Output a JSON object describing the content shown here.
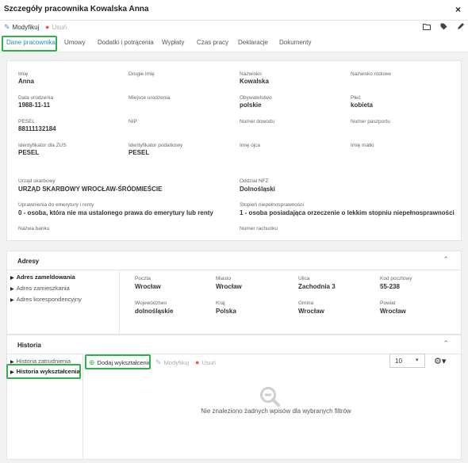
{
  "window": {
    "title": "Szczegóły pracownika Kowalska Anna",
    "close_label": "×"
  },
  "toolbar": {
    "modify_label": "Modyfikuj",
    "delete_label": "Usuń"
  },
  "tabs": [
    {
      "label": "Dane pracownika",
      "active": true
    },
    {
      "label": "Umowy"
    },
    {
      "label": "Dodatki i potrącenia"
    },
    {
      "label": "Wypłaty"
    },
    {
      "label": "Czas pracy"
    },
    {
      "label": "Deklaracje"
    },
    {
      "label": "Dokumenty"
    }
  ],
  "details": {
    "imie": {
      "label": "Imię",
      "value": "Anna"
    },
    "drugie_imie": {
      "label": "Drugie imię",
      "value": ""
    },
    "nazwisko": {
      "label": "Nazwisko",
      "value": "Kowalska"
    },
    "nazwisko_rodowe": {
      "label": "Nazwisko rodowe",
      "value": ""
    },
    "data_urodzenia": {
      "label": "Data urodzenia",
      "value": "1988-11-11"
    },
    "miejsce_urodzenia": {
      "label": "Miejsce urodzenia",
      "value": ""
    },
    "obywatelstwo": {
      "label": "Obywatelstwo",
      "value": "polskie"
    },
    "plec": {
      "label": "Płeć",
      "value": "kobieta"
    },
    "pesel": {
      "label": "PESEL",
      "value": "88111132184"
    },
    "nip": {
      "label": "NIP",
      "value": ""
    },
    "numer_dowodu": {
      "label": "Numer dowodu",
      "value": ""
    },
    "numer_paszportu": {
      "label": "Numer paszportu",
      "value": ""
    },
    "id_zus": {
      "label": "Identyfikator dla ZUS",
      "value": "PESEL"
    },
    "id_podatkowy": {
      "label": "Identyfikator podatkowy",
      "value": "PESEL"
    },
    "imie_ojca": {
      "label": "Imię ojca",
      "value": ""
    },
    "imie_matki": {
      "label": "Imię matki",
      "value": ""
    },
    "urzad_skarbowy": {
      "label": "Urząd skarbowy",
      "value": "URZĄD SKARBOWY WROCŁAW-ŚRÓDMIEŚCIE"
    },
    "oddzial_nfz": {
      "label": "Oddział NFZ",
      "value": "Dolnośląski"
    },
    "uprawnienia": {
      "label": "Uprawnienia do emerytury i renty",
      "value": "0 - osoba, która nie ma ustalonego prawa do emerytury lub renty"
    },
    "niepelnosprawnosc": {
      "label": "Stopień niepełnosprawności",
      "value": "1 - osoba posiadająca orzeczenie o lekkim stopniu niepełnosprawności"
    },
    "nazwa_banku": {
      "label": "Nazwa banku",
      "value": ""
    },
    "numer_rachunku": {
      "label": "Numer rachunku",
      "value": ""
    }
  },
  "addresses": {
    "title": "Adresy",
    "side": [
      "Adres zameldowania",
      "Adres zamieszkania",
      "Adres korespondencyjny"
    ],
    "poczta": {
      "label": "Poczta",
      "value": "Wrocław"
    },
    "miasto": {
      "label": "Miasto",
      "value": "Wrocław"
    },
    "ulica": {
      "label": "Ulica",
      "value": "Zachodnia 3"
    },
    "kod": {
      "label": "Kod pocztowy",
      "value": "55-238"
    },
    "wojewodztwo": {
      "label": "Województwo",
      "value": "dolnośląskie"
    },
    "kraj": {
      "label": "Kraj",
      "value": "Polska"
    },
    "gmina": {
      "label": "Gmina",
      "value": "Wrocław"
    },
    "powiat": {
      "label": "Powiat",
      "value": "Wrocław"
    }
  },
  "history": {
    "title": "Historia",
    "side": [
      "Historia zatrudnienia",
      "Historia wykształcenia"
    ],
    "add_label": "Dodaj wykształcenie",
    "modify_label": "Modyfikuj",
    "delete_label": "Usuń",
    "page_size": "10",
    "empty_text": "Nie znaleziono żadnych wpisów dla wybranych filtrów"
  },
  "colors": {
    "accent": "#2f86c9",
    "highlight": "#2db34a",
    "danger": "#e55555"
  }
}
